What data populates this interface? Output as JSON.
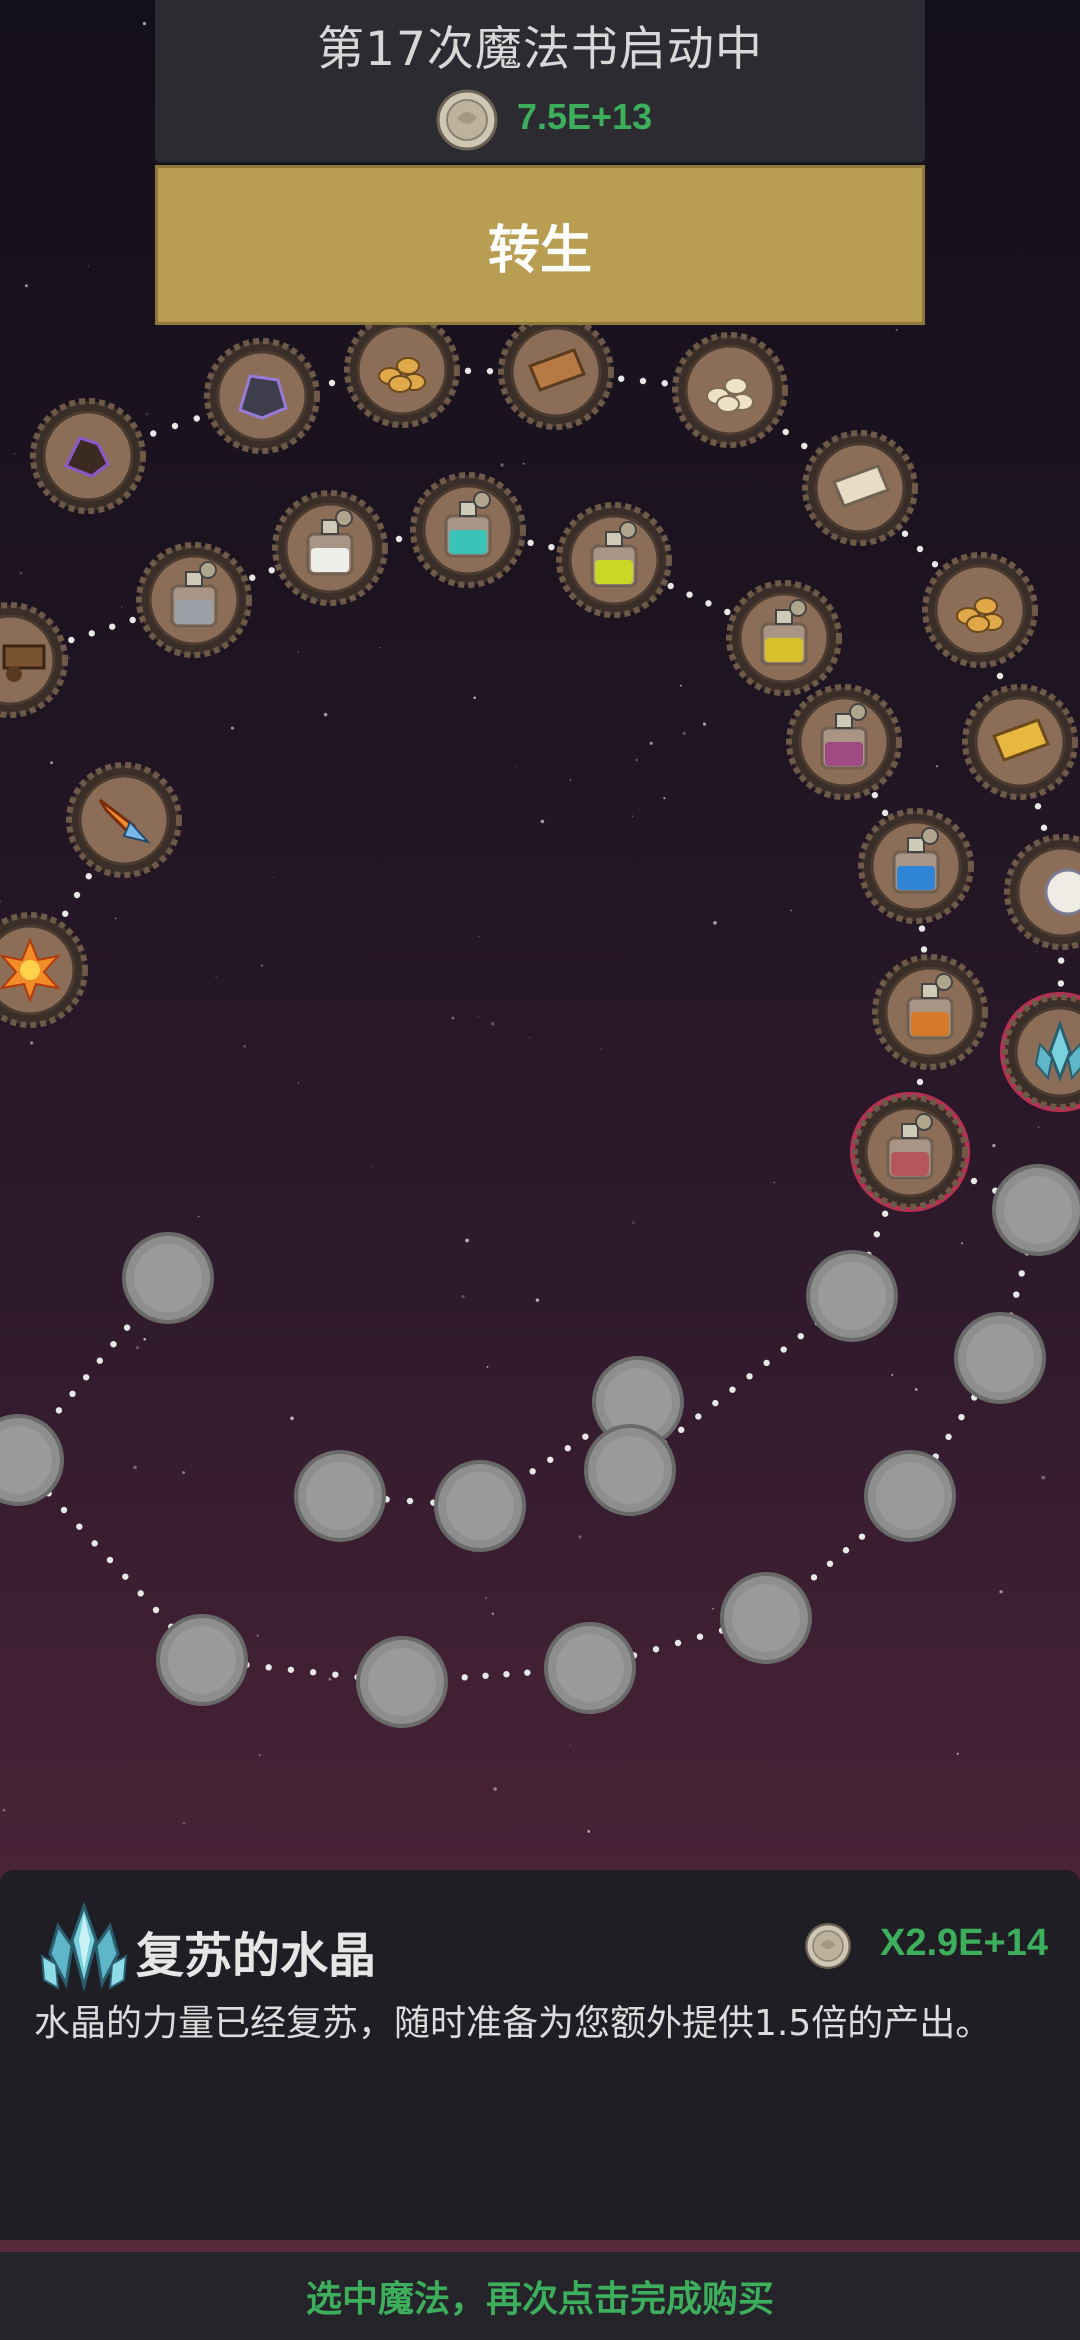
{
  "header": {
    "title": "第17次魔法书启动中",
    "coin_icon": "silver-coin-icon",
    "amount": "7.5E+13"
  },
  "rebirth_button": {
    "label": "转生"
  },
  "colors": {
    "accent_gold": "#b89d52",
    "currency_green": "#3cae5c",
    "selected_ring": "#d3335c",
    "locked_node": "#9a9a9a"
  },
  "spell_nodes": [
    {
      "name": "coal-icon",
      "state": "owned"
    },
    {
      "name": "dark-ore-icon",
      "state": "owned"
    },
    {
      "name": "gold-nuggets-icon",
      "state": "owned"
    },
    {
      "name": "copper-ingot-icon",
      "state": "owned"
    },
    {
      "name": "silver-nuggets-icon",
      "state": "owned"
    },
    {
      "name": "silver-bar-icon",
      "state": "owned"
    },
    {
      "name": "gold-nuggets-2-icon",
      "state": "owned"
    },
    {
      "name": "gold-ingot-icon",
      "state": "owned"
    },
    {
      "name": "pearl-icon",
      "state": "owned"
    },
    {
      "name": "crystal-icon",
      "state": "selected"
    },
    {
      "name": "grey-potion-icon",
      "state": "owned"
    },
    {
      "name": "white-potion-icon",
      "state": "owned"
    },
    {
      "name": "cyan-potion-icon",
      "state": "owned"
    },
    {
      "name": "lime-potion-icon",
      "state": "owned"
    },
    {
      "name": "yellow-potion-icon",
      "state": "owned"
    },
    {
      "name": "pink-potion-icon",
      "state": "owned"
    },
    {
      "name": "blue-potion-icon",
      "state": "owned"
    },
    {
      "name": "orange-potion-icon",
      "state": "owned"
    },
    {
      "name": "red-potion-icon",
      "state": "selected"
    },
    {
      "name": "wagon-icon",
      "state": "owned"
    },
    {
      "name": "fire-arrow-icon",
      "state": "owned"
    },
    {
      "name": "fire-burst-icon",
      "state": "owned"
    },
    {
      "name": "locked-node",
      "state": "locked"
    }
  ],
  "info_panel": {
    "icon": "crystal-icon",
    "name": "复苏的水晶",
    "cost_icon": "silver-coin-icon",
    "cost": "X2.9E+14",
    "description": "水晶的力量已经复苏，随时准备为您额外提供1.5倍的产出。"
  },
  "hint": "选中魔法，再次点击完成购买"
}
